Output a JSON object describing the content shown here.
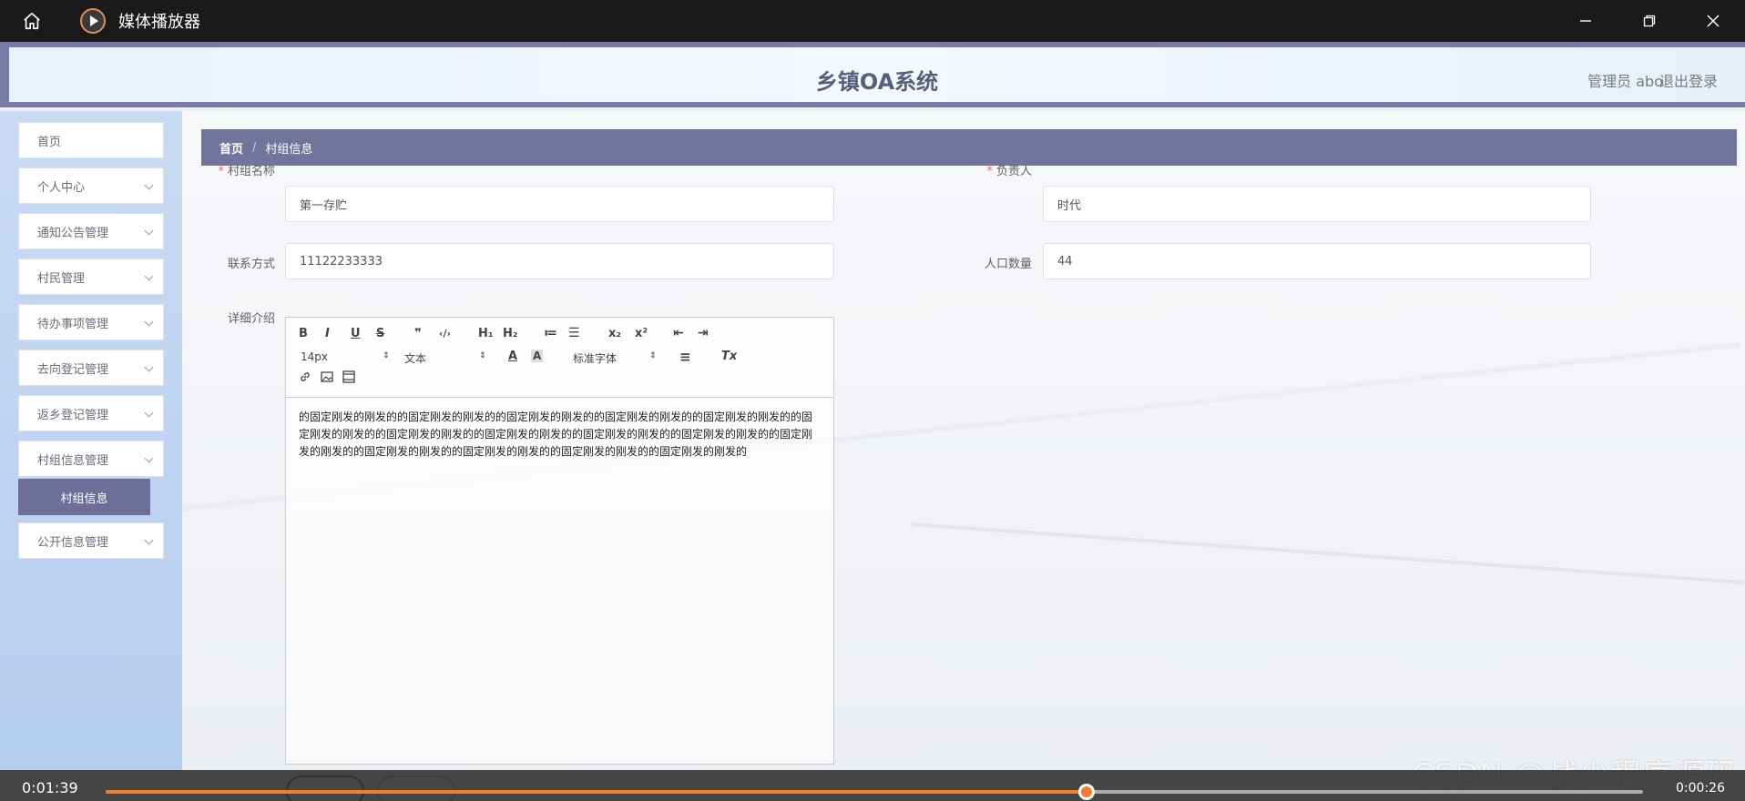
{
  "player": {
    "title": "媒体播放器",
    "time_elapsed": "0:01:39",
    "time_remaining": "0:00:26",
    "progress_fraction": 0.638
  },
  "header": {
    "system_title": "乡镇OA系统",
    "user": "管理员 abo",
    "logout": "退出登录"
  },
  "sidebar": {
    "items": [
      {
        "label": "首页"
      },
      {
        "label": "个人中心"
      },
      {
        "label": "通知公告管理"
      },
      {
        "label": "村民管理"
      },
      {
        "label": "待办事项管理"
      },
      {
        "label": "去向登记管理"
      },
      {
        "label": "返乡登记管理"
      },
      {
        "label": "村组信息管理"
      },
      {
        "label": "公开信息管理"
      }
    ],
    "active_sub": "村组信息"
  },
  "breadcrumb": {
    "home": "首页",
    "sep": "/",
    "current": "村组信息"
  },
  "form": {
    "village_name": {
      "label": "村组名称",
      "value": "第一存贮"
    },
    "leader": {
      "label": "负责人",
      "value": "时代"
    },
    "contact": {
      "label": "联系方式",
      "value": "11122233333"
    },
    "population": {
      "label": "人口数量",
      "value": "44"
    },
    "detail": {
      "label": "详细介绍",
      "content": "的固定刚发的刚发的的固定刚发的刚发的的固定刚发的刚发的的固定刚发的刚发的的固定刚发的刚发的的固定刚发的刚发的的固定刚发的刚发的的固定刚发的刚发的的固定刚发的刚发的的固定刚发的刚发的的固定刚发的刚发的的固定刚发的刚发的的固定刚发的刚发的的固定刚发的刚发的的固定刚发的刚发的"
    },
    "toolbar": {
      "bold": "B",
      "italic": "I",
      "underline": "U",
      "strike": "S",
      "quote": "❞",
      "code": "‹/›",
      "h1": "H₁",
      "h2": "H₂",
      "ol": "≔",
      "ul": "☰",
      "sub": "x₂",
      "sup": "x²",
      "indent_dec": "⇤",
      "indent_inc": "⇥",
      "size": "14px",
      "header": "文本",
      "color": "A",
      "bg": "A",
      "font": "标准字体",
      "align": "≡",
      "clean": "Tx",
      "link": "🔗",
      "image": "▣",
      "video": "▤"
    }
  },
  "watermark": "CSDN @战少程序源码"
}
